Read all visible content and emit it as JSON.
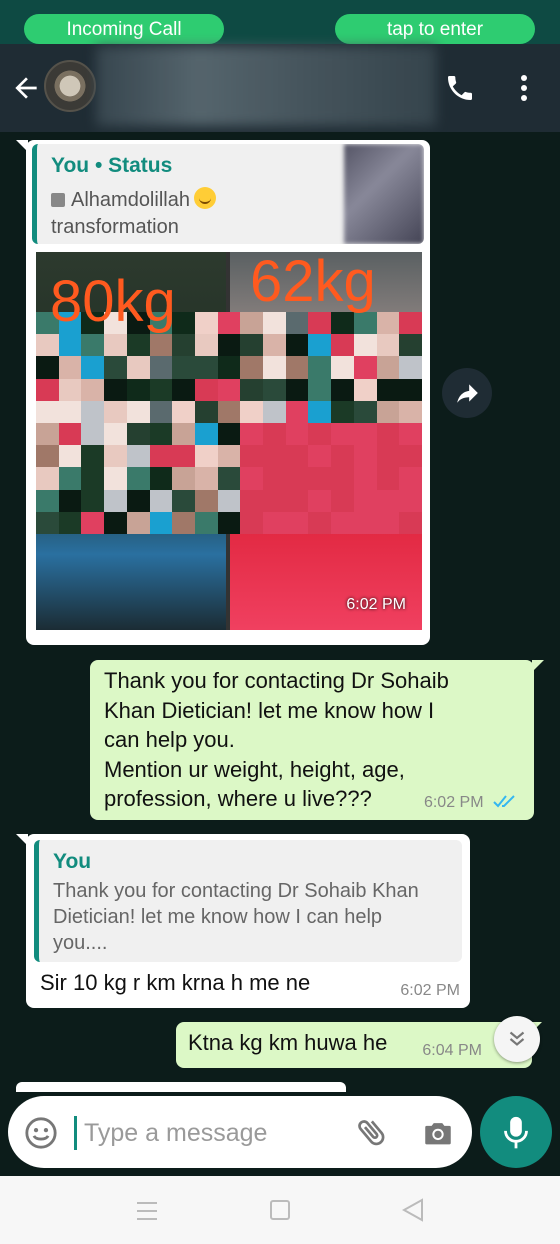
{
  "call_banner": {
    "left_label": "Incoming Call",
    "right_label": "tap to enter"
  },
  "header": {
    "contact_name": ""
  },
  "status_reply": {
    "author": "You • Status",
    "line1": "Alhamdolillah",
    "line2": "transformation",
    "image_text_left": "80kg",
    "image_text_right": "62kg",
    "time": "6:02 PM"
  },
  "messages": [
    {
      "direction": "out",
      "lines": [
        "Thank you for contacting Dr Sohaib",
        "Khan Dietician! let me know how I",
        "can help you.",
        "Mention ur weight, height, age,",
        "profession, where u live???"
      ],
      "time": "6:02 PM",
      "status": "read"
    },
    {
      "direction": "in",
      "quote_author": "You",
      "quote_lines": [
        "Thank you for contacting Dr Sohaib Khan",
        "Dietician! let me know how I can help",
        "you...."
      ],
      "text": "Sir 10 kg r km krna h me ne",
      "time": "6:02 PM"
    },
    {
      "direction": "out",
      "text": "Ktna kg km huwa he",
      "time": "6:04 PM"
    }
  ],
  "composer": {
    "placeholder": "Type a message"
  },
  "colors": {
    "header_bg": "#1f2c34",
    "chat_bg": "#0c1c1a",
    "outgoing_bubble": "#dcf8c6",
    "incoming_bubble": "#ffffff",
    "accent": "#128c7e",
    "call_pill": "#2ecc71",
    "read_ticks": "#34b7f1"
  },
  "icons": [
    "back-arrow-icon",
    "phone-icon",
    "more-vert-icon",
    "forward-icon",
    "double-check-icon",
    "chevron-double-down-icon",
    "emoji-icon",
    "paperclip-icon",
    "camera-icon",
    "mic-icon"
  ]
}
